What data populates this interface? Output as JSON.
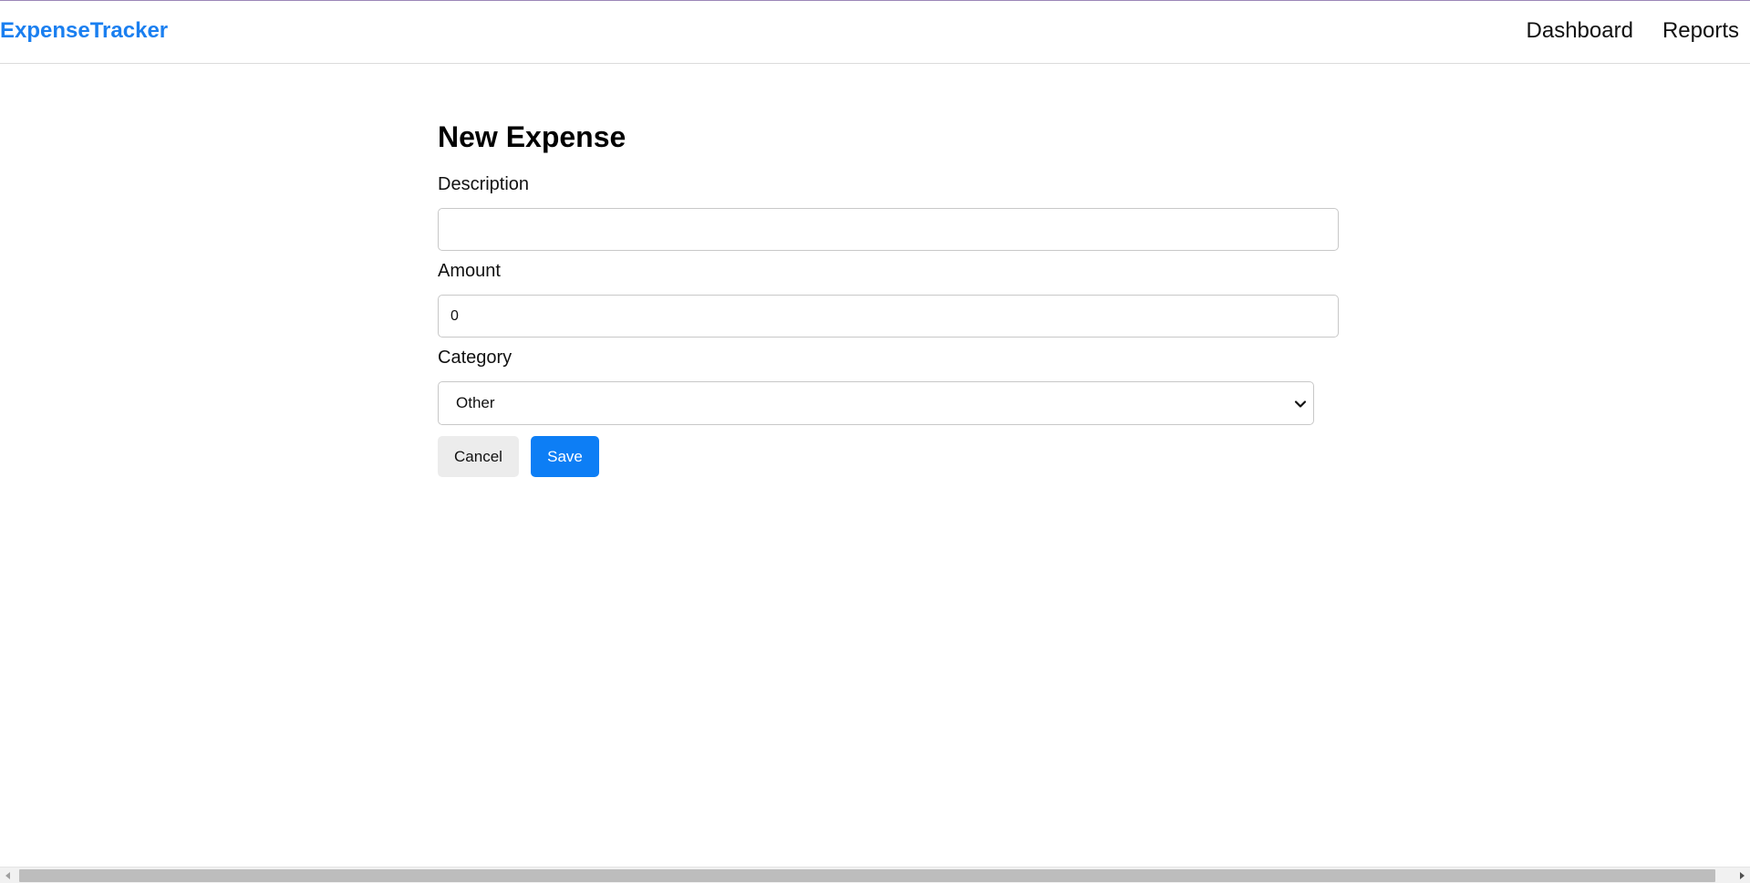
{
  "navbar": {
    "brand": "ExpenseTracker",
    "links": [
      "Dashboard",
      "Reports"
    ]
  },
  "form": {
    "title": "New Expense",
    "description": {
      "label": "Description",
      "value": ""
    },
    "amount": {
      "label": "Amount",
      "value": "0"
    },
    "category": {
      "label": "Category",
      "selected": "Other"
    },
    "cancel_label": "Cancel",
    "save_label": "Save"
  },
  "colors": {
    "brand": "#1a7ff0",
    "primary_button": "#0d7ef5",
    "secondary_button": "#ececec"
  },
  "icons": [
    "chevron-down-icon",
    "scroll-left-arrow-icon",
    "scroll-right-arrow-icon"
  ]
}
